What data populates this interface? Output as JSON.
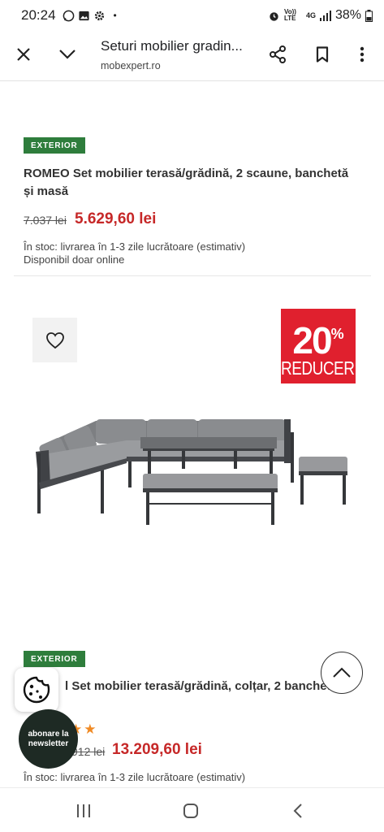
{
  "status_bar": {
    "time": "20:24",
    "left_icons": [
      "whatsapp-icon",
      "gallery-icon",
      "settings-icon"
    ],
    "dot": "•",
    "network_volte": "Vo)) LTE",
    "network_4g": "4G",
    "battery": "38%"
  },
  "browser": {
    "page_title": "Seturi mobilier gradin...",
    "url": "mobexpert.ro"
  },
  "products": [
    {
      "badge": "EXTERIOR",
      "title": "ROMEO Set mobilier terasă/grădină, 2 scaune, banchetă și masă",
      "old_price": "7.037 lei",
      "new_price": "5.629,60 lei",
      "stock": "În stoc: livrarea în 1-3 zile lucrătoare (estimativ)",
      "availability": "Disponibil doar online"
    },
    {
      "badge": "EXTERIOR",
      "promo_percent": "20",
      "promo_symbol": "%",
      "promo_label": "REDUCERE",
      "title": "l Set mobilier terasă/grădină, colțar, 2 banchete",
      "stars": "★★",
      "old_price": "912 lei",
      "new_price": "13.209,60 lei",
      "stock": "În stoc: livrarea în 1-3 zile lucrătoare (estimativ)"
    }
  ],
  "floating": {
    "newsletter_label": "abonare la newsletter"
  },
  "colors": {
    "badge_green": "#2e7d3c",
    "price_red": "#c62828",
    "promo_red": "#e0202e",
    "star_orange": "#f08a24",
    "newsletter_bg": "#1e2a24"
  }
}
